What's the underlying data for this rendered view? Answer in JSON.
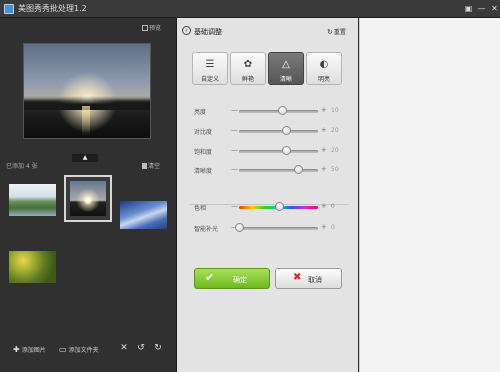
{
  "window": {
    "title": "美图秀秀批处理1.2",
    "controls": [
      "▣",
      "—",
      "✕"
    ]
  },
  "left_panel": {
    "preview_label": "预览",
    "added_count_text": "已添加 4 张",
    "clear_label": "清空",
    "collapse_glyph": "▲",
    "thumbnails": [
      {
        "name": "lake-trees",
        "selected": false
      },
      {
        "name": "sunset-lake",
        "selected": true
      },
      {
        "name": "blue-water",
        "selected": false
      },
      {
        "name": "autumn-leaves",
        "selected": false
      }
    ],
    "bottom": {
      "add_image_label": "添加图片",
      "add_folder_label": "添加文件夹",
      "add_image_icon": "✚",
      "add_folder_icon": "▭",
      "delete_icon": "✕",
      "rotate_left_icon": "↺",
      "rotate_right_icon": "↻"
    }
  },
  "edit_panel": {
    "back_icon": "‹",
    "title": "基础调整",
    "reset_label": "重置",
    "reset_icon": "↻",
    "tabs": [
      {
        "label": "自定义",
        "icon": "☰",
        "active": false
      },
      {
        "label": "鲜艳",
        "icon": "✿",
        "active": false
      },
      {
        "label": "清晰",
        "icon": "△",
        "active": true
      },
      {
        "label": "明亮",
        "icon": "◐",
        "active": false
      }
    ],
    "sliders": [
      {
        "label": "亮度",
        "value": "10",
        "position_fraction": 0.55,
        "hue": false
      },
      {
        "label": "对比度",
        "value": "20",
        "position_fraction": 0.6,
        "hue": false
      },
      {
        "label": "饱和度",
        "value": "20",
        "position_fraction": 0.6,
        "hue": false
      },
      {
        "label": "清晰度",
        "value": "50",
        "position_fraction": 0.75,
        "hue": false
      },
      {
        "label": "色相",
        "value": "0",
        "position_fraction": 0.5,
        "hue": true
      },
      {
        "label": "智能补光",
        "value": "0",
        "position_fraction": 0.0,
        "hue": false
      }
    ],
    "minus_glyph": "—",
    "plus_glyph": "+",
    "ok_label": "确定",
    "ok_icon": "✔",
    "cancel_label": "取消",
    "cancel_icon": "✖"
  }
}
